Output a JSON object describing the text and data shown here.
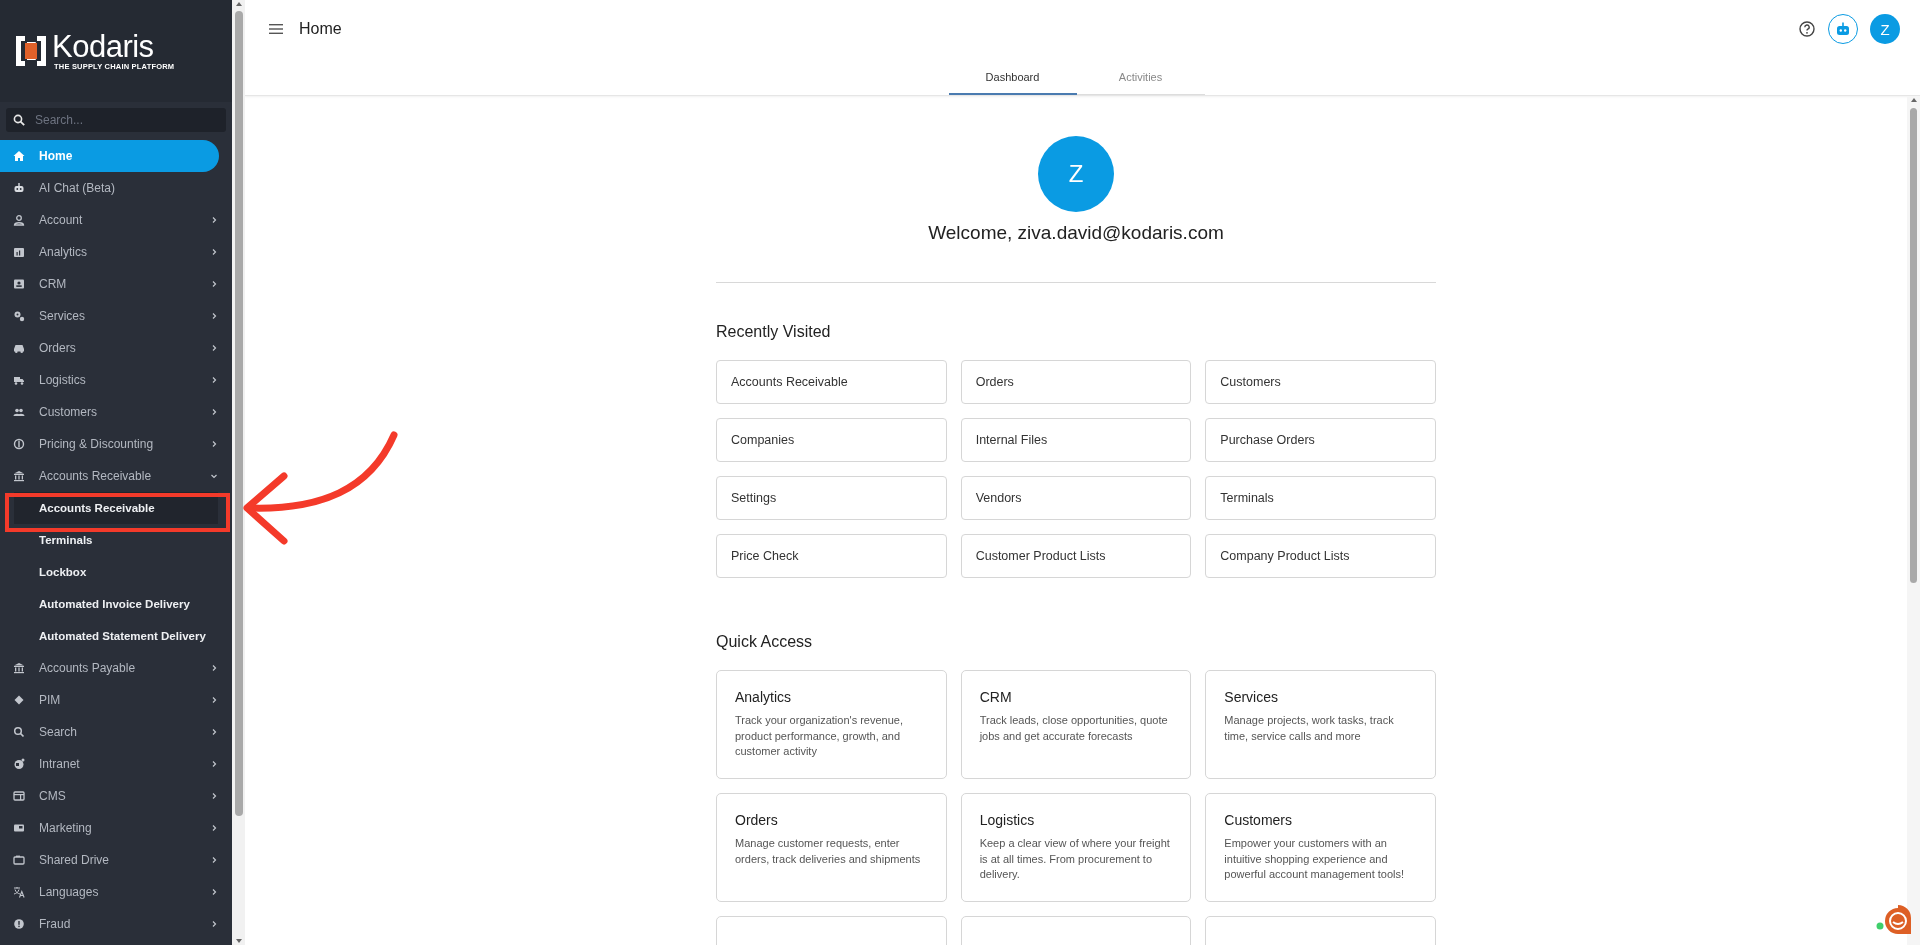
{
  "logo": {
    "name": "Kodaris",
    "tagline": "THE SUPPLY CHAIN PLATFORM"
  },
  "sidebar": {
    "search": {
      "placeholder": "Search..."
    },
    "items": [
      {
        "label": "Home",
        "kind": "link",
        "selected": true
      },
      {
        "label": "AI Chat (Beta)",
        "kind": "link",
        "selected": false
      },
      {
        "label": "Account",
        "kind": "group",
        "selected": false,
        "expanded": false
      },
      {
        "label": "Analytics",
        "kind": "group",
        "selected": false,
        "expanded": false
      },
      {
        "label": "CRM",
        "kind": "group",
        "selected": false,
        "expanded": false
      },
      {
        "label": "Services",
        "kind": "group",
        "selected": false,
        "expanded": false
      },
      {
        "label": "Orders",
        "kind": "group",
        "selected": false,
        "expanded": false
      },
      {
        "label": "Logistics",
        "kind": "group",
        "selected": false,
        "expanded": false
      },
      {
        "label": "Customers",
        "kind": "group",
        "selected": false,
        "expanded": false
      },
      {
        "label": "Pricing & Discounting",
        "kind": "group",
        "selected": false,
        "expanded": false
      },
      {
        "label": "Accounts Receivable",
        "kind": "group",
        "selected": false,
        "expanded": true,
        "children": [
          {
            "label": "Accounts Receivable",
            "hovered": true
          },
          {
            "label": "Terminals",
            "hovered": false
          },
          {
            "label": "Lockbox",
            "hovered": false
          },
          {
            "label": "Automated Invoice Delivery",
            "hovered": false
          },
          {
            "label": "Automated Statement Delivery",
            "hovered": false
          }
        ]
      },
      {
        "label": "Accounts Payable",
        "kind": "group",
        "selected": false,
        "expanded": false
      },
      {
        "label": "PIM",
        "kind": "group",
        "selected": false,
        "expanded": false
      },
      {
        "label": "Search",
        "kind": "group",
        "selected": false,
        "expanded": false
      },
      {
        "label": "Intranet",
        "kind": "group",
        "selected": false,
        "expanded": false
      },
      {
        "label": "CMS",
        "kind": "group",
        "selected": false,
        "expanded": false
      },
      {
        "label": "Marketing",
        "kind": "group",
        "selected": false,
        "expanded": false
      },
      {
        "label": "Shared Drive",
        "kind": "group",
        "selected": false,
        "expanded": false
      },
      {
        "label": "Languages",
        "kind": "group",
        "selected": false,
        "expanded": false
      },
      {
        "label": "Fraud",
        "kind": "group",
        "selected": false,
        "expanded": false
      }
    ]
  },
  "header": {
    "title": "Home",
    "avatar": "Z"
  },
  "tabs": [
    {
      "label": "Dashboard",
      "selected": true
    },
    {
      "label": "Activities",
      "selected": false
    }
  ],
  "welcome": {
    "avatar": "Z",
    "text": "Welcome, ziva.david@kodaris.com"
  },
  "recently_visited": {
    "title": "Recently Visited",
    "items": [
      "Accounts Receivable",
      "Orders",
      "Customers",
      "Companies",
      "Internal Files",
      "Purchase Orders",
      "Settings",
      "Vendors",
      "Terminals",
      "Price Check",
      "Customer Product Lists",
      "Company Product Lists"
    ]
  },
  "quick_access": {
    "title": "Quick Access",
    "items": [
      {
        "title": "Analytics",
        "description": "Track your organization's revenue, product performance, growth, and customer activity"
      },
      {
        "title": "CRM",
        "description": "Track leads, close opportunities, quote jobs and get accurate forecasts"
      },
      {
        "title": "Services",
        "description": "Manage projects, work tasks, track time, service calls and more"
      },
      {
        "title": "Orders",
        "description": "Manage customer requests, enter orders, track deliveries and shipments"
      },
      {
        "title": "Logistics",
        "description": "Keep a clear view of where your freight is at all times. From procurement to delivery."
      },
      {
        "title": "Customers",
        "description": "Empower your customers with an intuitive shopping experience and powerful account management tools!"
      },
      {
        "kind": "card"
      },
      {
        "kind": "card"
      },
      {
        "kind": "card"
      }
    ]
  }
}
